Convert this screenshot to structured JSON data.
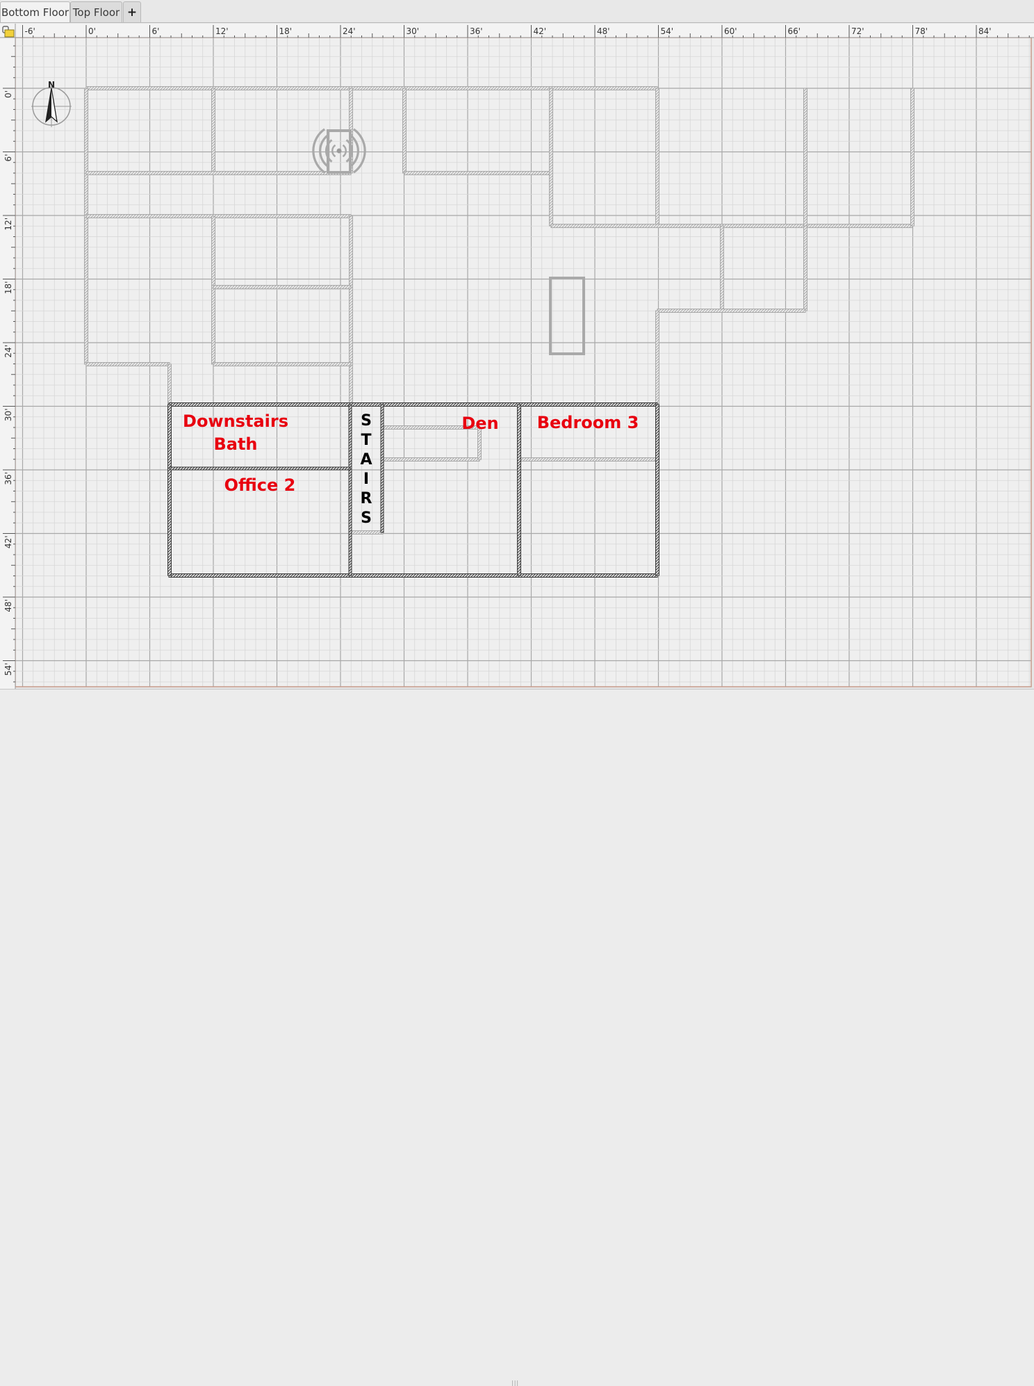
{
  "tabs": [
    {
      "label": "Bottom Floor",
      "active": true
    },
    {
      "label": "Top Floor",
      "active": false
    }
  ],
  "add_tab_label": "+",
  "ruler": {
    "top_labels": [
      "-6'",
      "0'",
      "6'",
      "12'",
      "18'",
      "24'",
      "30'",
      "36'",
      "42'",
      "48'",
      "54'",
      "60'",
      "66'",
      "72'",
      "78'",
      "84'"
    ],
    "left_labels": [
      "0'",
      "6'",
      "12'",
      "18'",
      "24'",
      "30'",
      "36'",
      "42'",
      "48'",
      "54'"
    ]
  },
  "compass_label": "N",
  "rooms": [
    {
      "name": "Downstairs",
      "name2": "Bath"
    },
    {
      "name": "Office 2"
    },
    {
      "name": "Den"
    },
    {
      "name": "Bedroom 3"
    }
  ],
  "stairs_letters": [
    "S",
    "T",
    "A",
    "I",
    "R",
    "S"
  ],
  "colors": {
    "room_label": "#e8000f",
    "grid_minor": "#d6d6d6",
    "grid_major": "#a8a8a8",
    "wall_gray": "#a9a9a9",
    "wall_dark": "#3a3a3a",
    "canvas_bg": "#efefef"
  },
  "icons": {
    "lock": "lock-icon",
    "compass": "compass-icon",
    "wifi": "wifi-icon"
  },
  "status_grip": "|||"
}
